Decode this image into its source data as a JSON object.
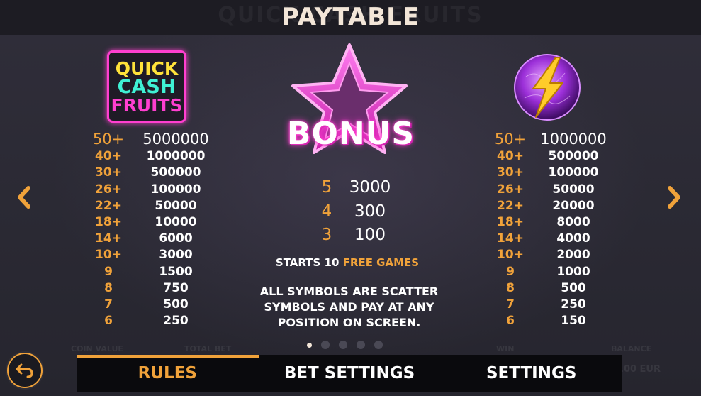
{
  "header": {
    "title": "PAYTABLE",
    "ghost_title": "QUICK CASH FRUITS"
  },
  "left_symbol": {
    "logo": {
      "line1": "QUICK",
      "line2": "CASH",
      "line3": "FRUITS"
    },
    "rows": [
      {
        "count": "50+",
        "value": "5000000"
      },
      {
        "count": "40+",
        "value": "1000000"
      },
      {
        "count": "30+",
        "value": "500000"
      },
      {
        "count": "26+",
        "value": "100000"
      },
      {
        "count": "22+",
        "value": "50000"
      },
      {
        "count": "18+",
        "value": "10000"
      },
      {
        "count": "14+",
        "value": "6000"
      },
      {
        "count": "10+",
        "value": "3000"
      },
      {
        "count": "9",
        "value": "1500"
      },
      {
        "count": "8",
        "value": "750"
      },
      {
        "count": "7",
        "value": "500"
      },
      {
        "count": "6",
        "value": "250"
      }
    ]
  },
  "bonus": {
    "label": "BONUS",
    "rows": [
      {
        "count": "5",
        "value": "3000"
      },
      {
        "count": "4",
        "value": "300"
      },
      {
        "count": "3",
        "value": "100"
      }
    ],
    "starts_prefix": "STARTS 10",
    "starts_highlight": "FREE GAMES",
    "scatter_line1": "ALL SYMBOLS ARE SCATTER",
    "scatter_line2": "SYMBOLS AND  PAY AT ANY",
    "scatter_line3": "POSITION ON SCREEN."
  },
  "right_symbol": {
    "icon": "lightning-orb-icon",
    "rows": [
      {
        "count": "50+",
        "value": "1000000"
      },
      {
        "count": "40+",
        "value": "500000"
      },
      {
        "count": "30+",
        "value": "100000"
      },
      {
        "count": "26+",
        "value": "50000"
      },
      {
        "count": "22+",
        "value": "20000"
      },
      {
        "count": "18+",
        "value": "8000"
      },
      {
        "count": "14+",
        "value": "4000"
      },
      {
        "count": "10+",
        "value": "2000"
      },
      {
        "count": "9",
        "value": "1000"
      },
      {
        "count": "8",
        "value": "500"
      },
      {
        "count": "7",
        "value": "250"
      },
      {
        "count": "6",
        "value": "150"
      }
    ]
  },
  "pagination": {
    "pages": 5,
    "active": 0
  },
  "ghost_bar": {
    "coin_value": "COIN VALUE",
    "total_bet": "TOTAL BET",
    "win": "WIN",
    "balance": "BALANCE",
    "balance_value": ".00 EUR"
  },
  "tabs": [
    {
      "label": "RULES"
    },
    {
      "label": "BET SETTINGS"
    },
    {
      "label": "SETTINGS"
    }
  ],
  "colors": {
    "accent": "#f0a23a",
    "neon_pink": "#ff3fd0",
    "background": "#2b2a35"
  },
  "icons": {
    "prev": "chevron-left-icon",
    "next": "chevron-right-icon",
    "back": "back-arrow-icon"
  }
}
